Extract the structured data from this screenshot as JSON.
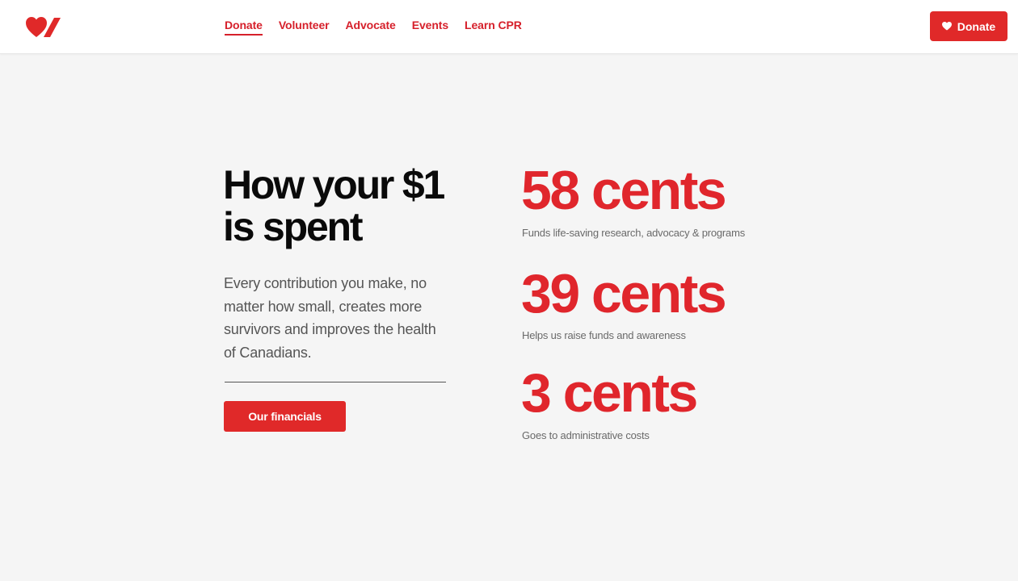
{
  "header": {
    "logo": "heart-and-stroke-logo-icon",
    "nav": [
      {
        "label": "Donate",
        "active": true
      },
      {
        "label": "Volunteer",
        "active": false
      },
      {
        "label": "Advocate",
        "active": false
      },
      {
        "label": "Events",
        "active": false
      },
      {
        "label": "Learn CPR",
        "active": false
      }
    ],
    "donate_button": {
      "label": "Donate",
      "icon": "heart-icon"
    }
  },
  "main": {
    "headline_line1": "How your $1",
    "headline_line2": "is spent",
    "intro": "Every contribution you make, no matter how small, creates more survivors and improves the health of Canadians.",
    "financials_button": "Our financials",
    "stats": [
      {
        "amount": "58 cents",
        "description": "Funds life-saving research, advocacy & programs"
      },
      {
        "amount": "39 cents",
        "description": "Helps us raise funds and awareness"
      },
      {
        "amount": "3 cents",
        "description": "Goes to administrative costs"
      }
    ]
  },
  "colors": {
    "brand_red": "#e02929",
    "background": "#f5f5f5",
    "header_bg": "#ffffff",
    "headline": "#0a0a0a",
    "body_text": "#555555",
    "description_text": "#6a6a6a"
  }
}
